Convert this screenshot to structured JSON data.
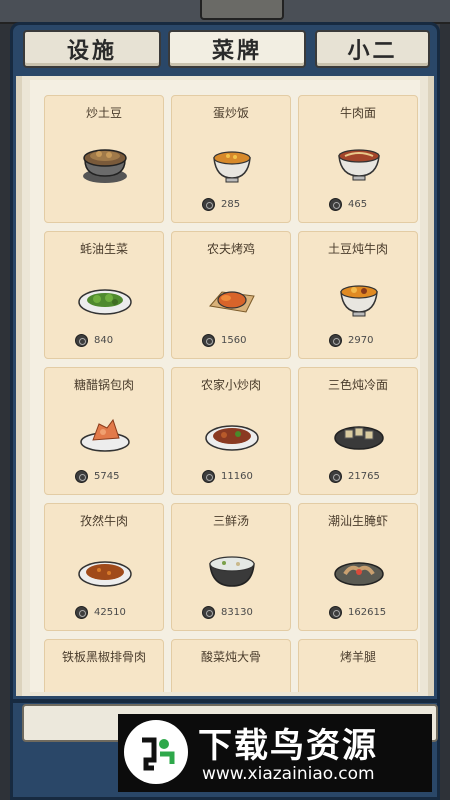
{
  "tabs": [
    {
      "label": "设施",
      "active": false
    },
    {
      "label": "菜牌",
      "active": true
    },
    {
      "label": "小二",
      "active": false
    }
  ],
  "dishes": [
    {
      "name": "炒土豆",
      "price": "",
      "icon": "clay-pot-icon"
    },
    {
      "name": "蛋炒饭",
      "price": "285",
      "icon": "fried-rice-bowl-icon"
    },
    {
      "name": "牛肉面",
      "price": "465",
      "icon": "noodle-bowl-icon"
    },
    {
      "name": "蚝油生菜",
      "price": "840",
      "icon": "greens-plate-icon"
    },
    {
      "name": "农夫烤鸡",
      "price": "1560",
      "icon": "roast-chicken-icon"
    },
    {
      "name": "土豆炖牛肉",
      "price": "2970",
      "icon": "beef-stew-bowl-icon"
    },
    {
      "name": "糖醋锅包肉",
      "price": "5745",
      "icon": "sweet-sour-pork-icon"
    },
    {
      "name": "农家小炒肉",
      "price": "11160",
      "icon": "stir-fry-plate-icon"
    },
    {
      "name": "三色炖冷面",
      "price": "21765",
      "icon": "cold-noodle-plate-icon"
    },
    {
      "name": "孜然牛肉",
      "price": "42510",
      "icon": "cumin-beef-plate-icon"
    },
    {
      "name": "三鲜汤",
      "price": "83130",
      "icon": "soup-bowl-icon"
    },
    {
      "name": "潮汕生腌虾",
      "price": "162615",
      "icon": "shrimp-plate-icon"
    },
    {
      "name": "铁板黑椒排骨肉",
      "price": "",
      "icon": "sizzling-ribs-icon"
    },
    {
      "name": "酸菜炖大骨",
      "price": "",
      "icon": "bone-stew-icon"
    },
    {
      "name": "烤羊腿",
      "price": "",
      "icon": "roast-lamb-leg-icon"
    }
  ],
  "watermark": {
    "title": "下载鸟资源",
    "url": "www.xiazainiao.com"
  },
  "colors": {
    "frame": "#2a4768",
    "card": "#f6e5c7",
    "tab": "#e7e2d4"
  }
}
